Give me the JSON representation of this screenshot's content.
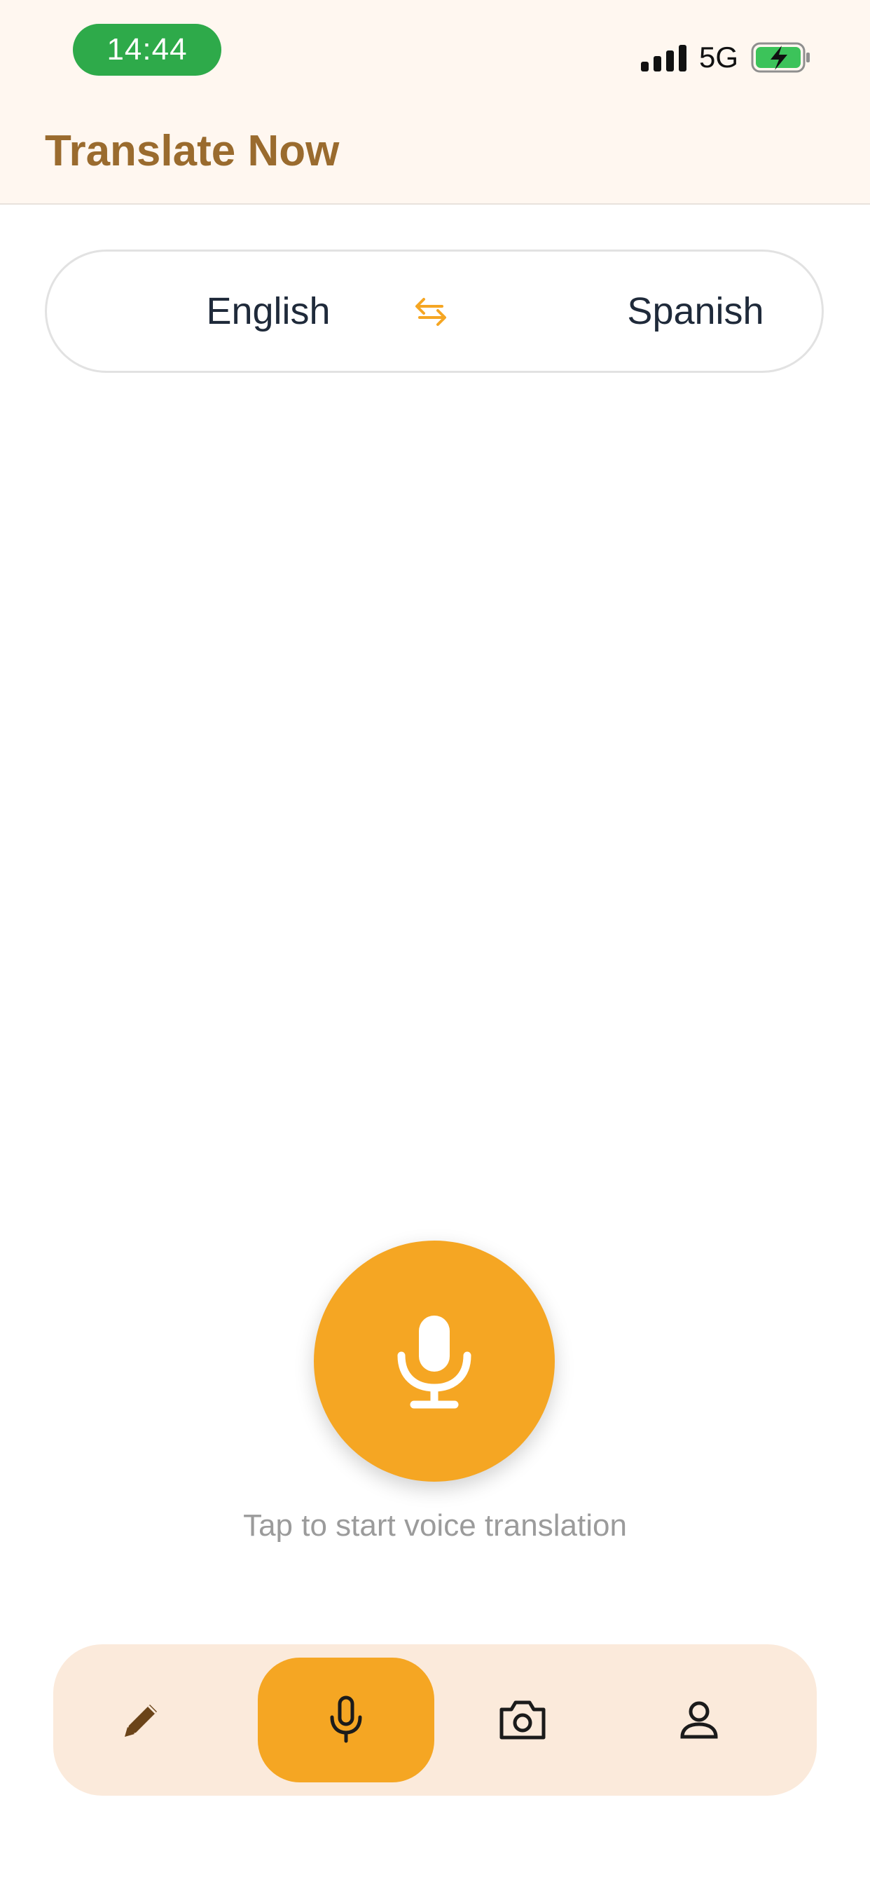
{
  "status_bar": {
    "time": "14:44",
    "network": "5G",
    "icons": [
      "signal-bars-icon",
      "battery-charging-icon"
    ]
  },
  "header": {
    "title": "Translate Now"
  },
  "language_selector": {
    "source": "English",
    "target": "Spanish",
    "swap_icon": "swap-arrows-icon"
  },
  "voice": {
    "icon": "microphone-icon",
    "hint": "Tap to start voice translation"
  },
  "bottom_nav": {
    "items": [
      {
        "name": "text",
        "icon": "pencil-icon",
        "active": false
      },
      {
        "name": "voice",
        "icon": "microphone-icon",
        "active": true
      },
      {
        "name": "camera",
        "icon": "camera-icon",
        "active": false
      },
      {
        "name": "profile",
        "icon": "person-icon",
        "active": false
      }
    ]
  },
  "colors": {
    "accent": "#f5a623",
    "title": "#9a6b2e",
    "header_bg": "#fff7f0",
    "nav_bg": "#fbeadb",
    "time_pill": "#2eaa4a",
    "text_dark": "#1f2a3a",
    "hint": "#9b9b9b"
  }
}
